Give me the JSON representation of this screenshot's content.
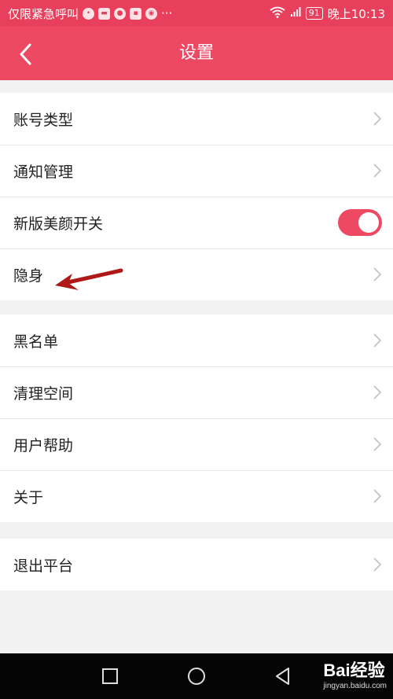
{
  "status_bar": {
    "carrier": "仅限紧急呼叫",
    "more": "···",
    "battery": "91",
    "time": "晚上10:13",
    "app_icons": [
      "message-icon",
      "chat-icon",
      "app-red-icon",
      "ppg-icon",
      "browser-icon"
    ]
  },
  "header": {
    "title": "设置"
  },
  "settings": {
    "group1": [
      {
        "label": "账号类型"
      },
      {
        "label": "通知管理"
      },
      {
        "label": "新版美颜开关",
        "toggle_on": true
      },
      {
        "label": "隐身"
      }
    ],
    "group2": [
      {
        "label": "黑名单"
      },
      {
        "label": "清理空间"
      },
      {
        "label": "用户帮助"
      },
      {
        "label": "关于"
      }
    ],
    "group3": [
      {
        "label": "退出平台"
      }
    ]
  },
  "nav_bar": {
    "watermark_brand": "Bai经验",
    "watermark_url": "jingyan.baidu.com"
  },
  "colors": {
    "accent": "#ee4963",
    "annotation_arrow": "#b01818"
  }
}
